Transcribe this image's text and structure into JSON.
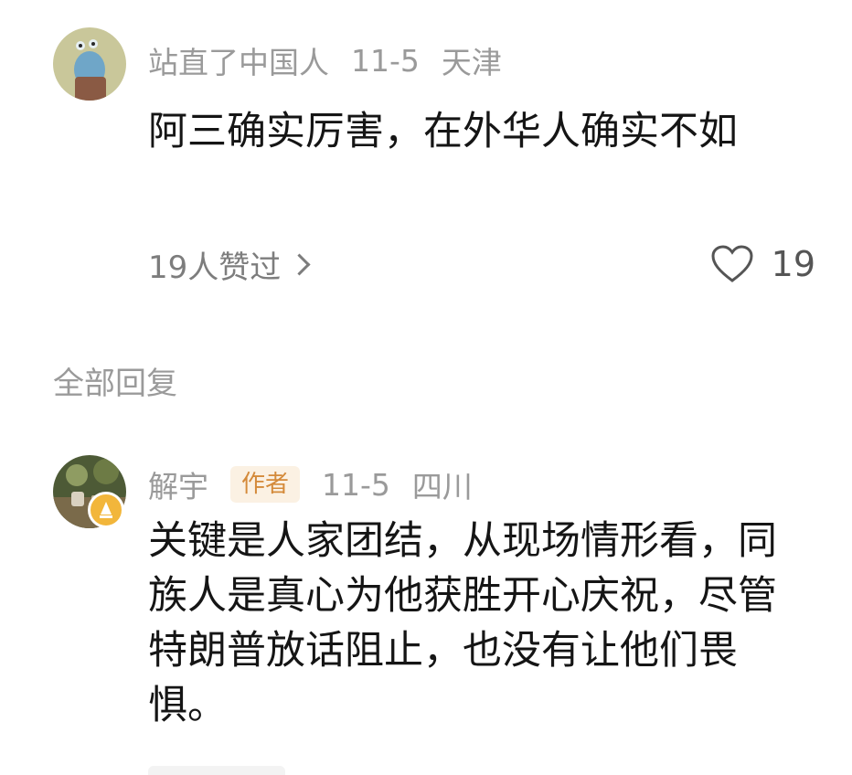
{
  "comment1": {
    "username": "站直了中国人",
    "date": "11-5",
    "location": "天津",
    "text": "阿三确实厉害，在外华人确实不如",
    "likes_link": "19人赞过",
    "like_count": "19"
  },
  "section": {
    "title": "全部回复"
  },
  "reply1": {
    "username": "解宇",
    "author_badge": "作者",
    "date": "11-5",
    "location": "四川",
    "text": "关键是人家团结，从现场情形看，同族人是真心为他获胜开心庆祝，尽管特朗普放话阻止，也没有让他们畏惧。"
  },
  "colors": {
    "meta_gray": "#9a9a9a",
    "text_dark": "#151515",
    "author_badge_text": "#d48a3a",
    "author_badge_bg": "#fbf1e3",
    "level_badge": "#f2b63b"
  },
  "icons": {
    "like": "heart-icon",
    "more": "chevron-right-icon",
    "level": "level-badge-icon"
  }
}
